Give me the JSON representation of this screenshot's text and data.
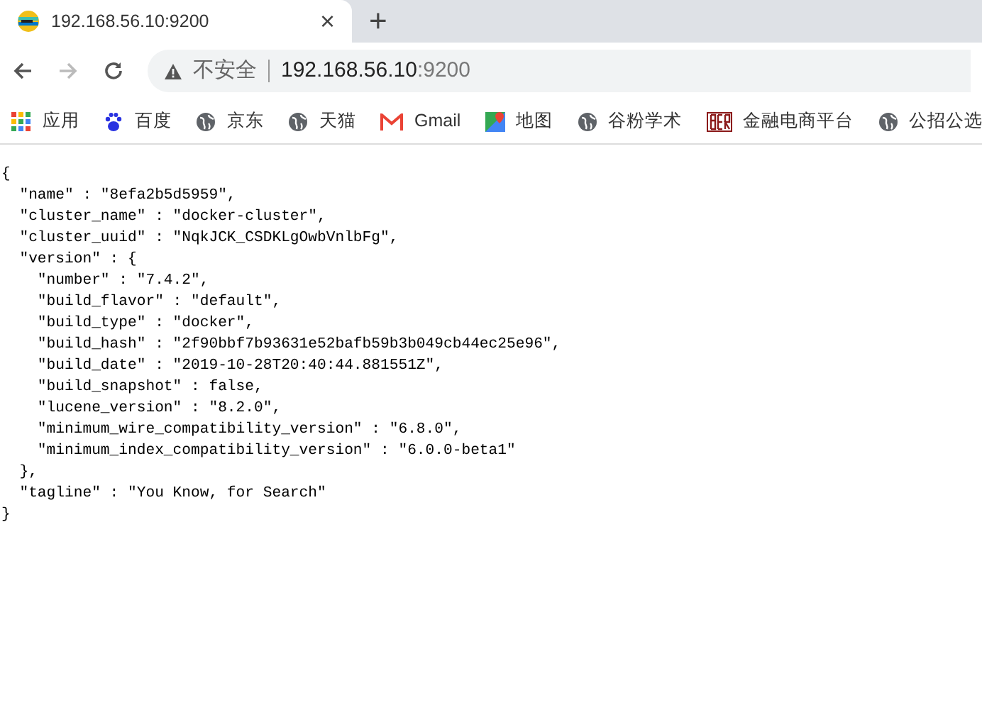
{
  "tab": {
    "title": "192.168.56.10:9200",
    "close": "×",
    "new_tab": "+"
  },
  "toolbar": {
    "security_label": "不安全",
    "url_host": "192.168.56.10",
    "url_port": ":9200"
  },
  "bookmarks": [
    {
      "kind": "apps",
      "label": "应用"
    },
    {
      "kind": "paw",
      "label": "百度"
    },
    {
      "kind": "globe",
      "label": "京东"
    },
    {
      "kind": "globe",
      "label": "天猫"
    },
    {
      "kind": "gmail",
      "label": "Gmail"
    },
    {
      "kind": "maps",
      "label": "地图"
    },
    {
      "kind": "globe",
      "label": "谷粉学术"
    },
    {
      "kind": "ber",
      "label": "金融电商平台"
    },
    {
      "kind": "globe",
      "label": "公招公选"
    }
  ],
  "body_lines": [
    "{",
    "  \"name\" : \"8efa2b5d5959\",",
    "  \"cluster_name\" : \"docker-cluster\",",
    "  \"cluster_uuid\" : \"NqkJCK_CSDKLgOwbVnlbFg\",",
    "  \"version\" : {",
    "    \"number\" : \"7.4.2\",",
    "    \"build_flavor\" : \"default\",",
    "    \"build_type\" : \"docker\",",
    "    \"build_hash\" : \"2f90bbf7b93631e52bafb59b3b049cb44ec25e96\",",
    "    \"build_date\" : \"2019-10-28T20:40:44.881551Z\",",
    "    \"build_snapshot\" : false,",
    "    \"lucene_version\" : \"8.2.0\",",
    "    \"minimum_wire_compatibility_version\" : \"6.8.0\",",
    "    \"minimum_index_compatibility_version\" : \"6.0.0-beta1\"",
    "  },",
    "  \"tagline\" : \"You Know, for Search\"",
    "}"
  ]
}
